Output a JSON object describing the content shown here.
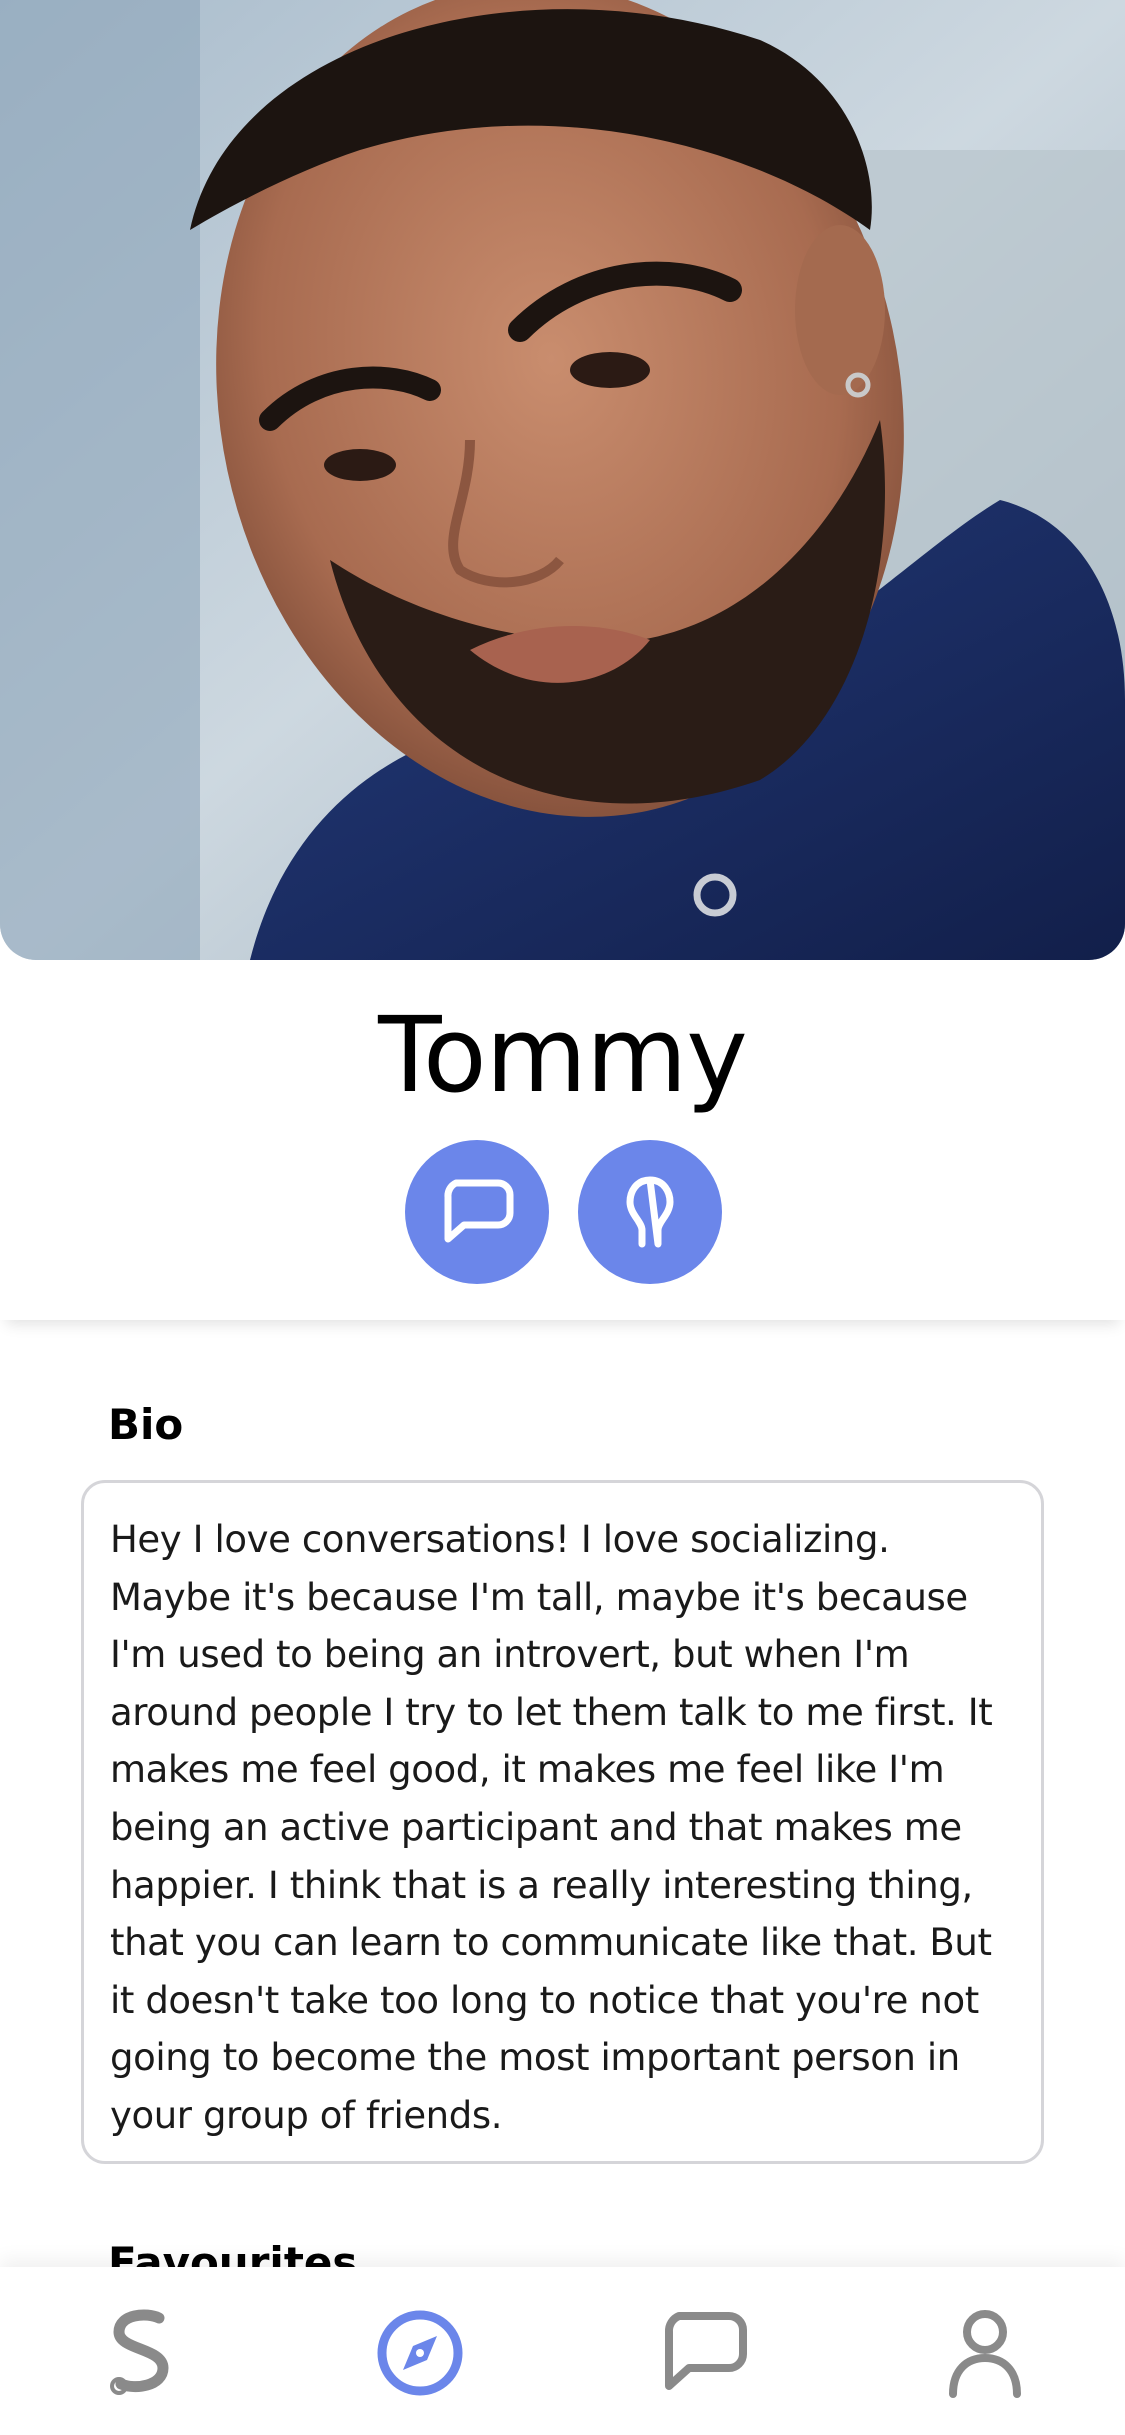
{
  "profile": {
    "name": "Tommy",
    "photo_alt": "Profile photo of Tommy"
  },
  "actions": {
    "message_icon": "chat-bubble-icon",
    "pin_icon": "location-pin-icon"
  },
  "bio": {
    "heading": "Bio",
    "text": "Hey I love conversations! I love socializing. Maybe it's because I'm tall, maybe it's because I'm used to being an introvert, but when I'm around people I try to let them talk to me first. It makes me feel good, it makes me feel like I'm being an active participant and that makes me happier. I think that is a really interesting thing, that you can learn to communicate like that. But it doesn't take too long to notice that you're not going to become the most important person in your group of friends."
  },
  "favourites": {
    "heading": "Favourites"
  },
  "nav": {
    "items": [
      {
        "icon": "app-logo-icon",
        "active": false
      },
      {
        "icon": "compass-icon",
        "active": true
      },
      {
        "icon": "chat-bubble-icon",
        "active": false
      },
      {
        "icon": "user-icon",
        "active": false
      }
    ]
  },
  "colors": {
    "accent": "#6b86ea",
    "nav_inactive": "#8a8a8a",
    "border": "#d5d5d9"
  }
}
